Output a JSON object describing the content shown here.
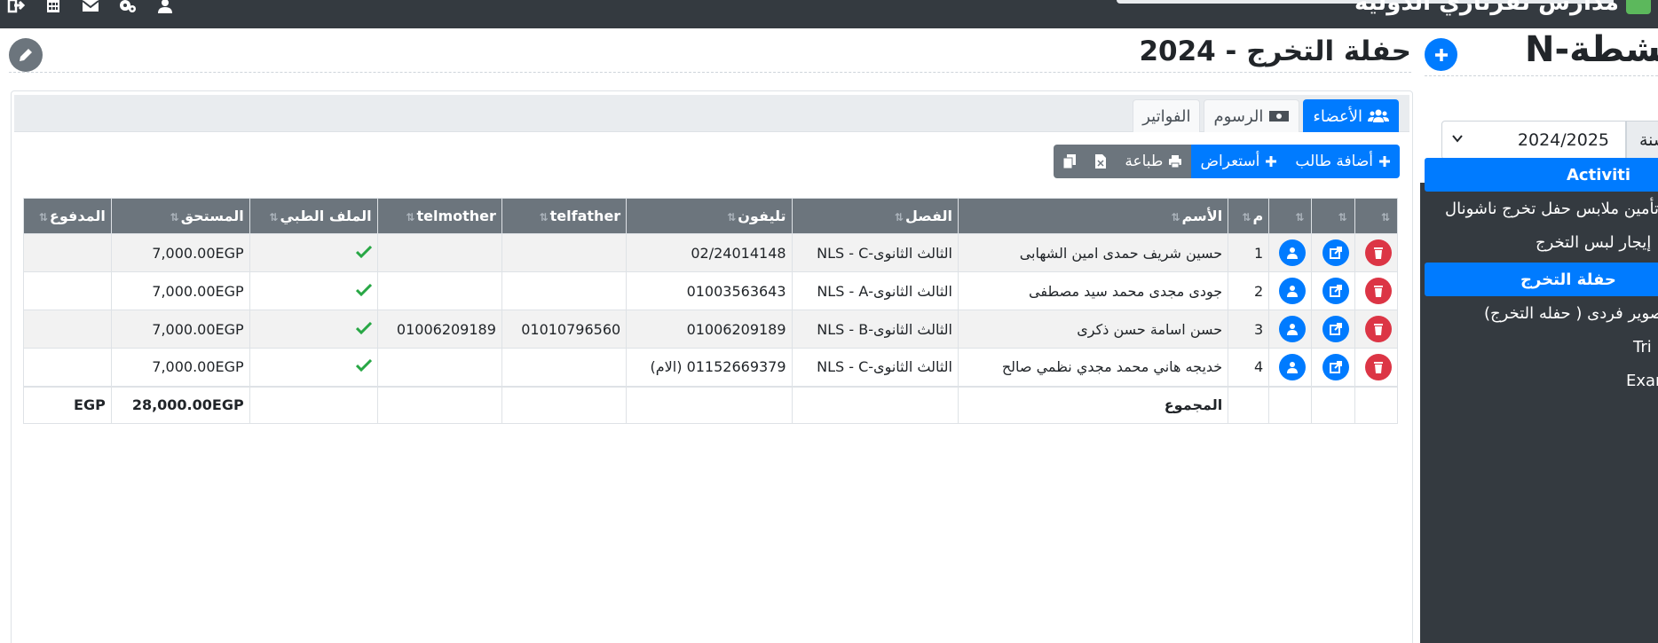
{
  "topbar": {
    "brand": "مدارس نفرتاري الدولية",
    "icons": [
      "sign-out-icon",
      "calculator-icon",
      "envelope-icon",
      "cogs-icon",
      "user-icon"
    ]
  },
  "main": {
    "title": "حفلة التخرج - 2024",
    "tabs": [
      {
        "label": "الأعضاء",
        "icon": "users-icon",
        "active": true
      },
      {
        "label": "الرسوم",
        "icon": "money-bill-icon",
        "active": false
      },
      {
        "label": "الفواتير",
        "icon": "",
        "active": false
      }
    ],
    "toolbar": {
      "add_student": "أضافة طالب",
      "browse": "أستعراض",
      "print": "طباعة",
      "excel_icon": "file-excel-icon",
      "copy_icon": "copy-icon"
    },
    "table": {
      "columns": [
        "",
        "",
        "",
        "م",
        "الأسم",
        "الفصل",
        "تليفون",
        "telfather",
        "telmother",
        "الملف الطبي",
        "المستحق",
        "المدفوع"
      ],
      "rows": [
        {
          "num": "1",
          "name": "حسين شريف حمدى امين الشهابى",
          "class": "الثالث الثانوى-NLS - C",
          "phone": "02/24014148",
          "telfather": "",
          "telmother": "",
          "medical": true,
          "due": "7,000.00EGP",
          "paid": ""
        },
        {
          "num": "2",
          "name": "جودى مجدى محمد سيد مصطفى",
          "class": "الثالث الثانوى-NLS - A",
          "phone": "01003563643",
          "telfather": "",
          "telmother": "",
          "medical": true,
          "due": "7,000.00EGP",
          "paid": ""
        },
        {
          "num": "3",
          "name": "حسن اسامة حسن ذكرى",
          "class": "الثالث الثانوى-NLS - B",
          "phone": "01006209189",
          "telfather": "01010796560",
          "telmother": "01006209189",
          "medical": true,
          "due": "7,000.00EGP",
          "paid": ""
        },
        {
          "num": "4",
          "name": "خديجه هاني محمد مجدي نظمي صالح",
          "class": "الثالث الثانوى-NLS - C",
          "phone": "01152669379 (الام)",
          "telfather": "",
          "telmother": "",
          "medical": true,
          "due": "7,000.00EGP",
          "paid": ""
        }
      ],
      "footer": {
        "label": "المجموع",
        "due_total": "28,000.00EGP",
        "paid_total": "EGP"
      }
    }
  },
  "sidebar": {
    "title": "N-انشطة",
    "year_label": "السنة",
    "year_value": "2024/2025",
    "items": [
      {
        "label": "Activiti",
        "head": true
      },
      {
        "label": "تأمين ملابس حفل تخرج ناشونال",
        "head": false
      },
      {
        "label": "إيجار لبس التخرج",
        "head": false
      },
      {
        "label": "حفلة التخرج",
        "head": true
      },
      {
        "label": "تصوير فردى ( حفله التخرج)",
        "head": false
      },
      {
        "label": "Tri",
        "head": false
      },
      {
        "label": "Exan",
        "head": false
      }
    ]
  },
  "colors": {
    "primary": "#007bff",
    "secondary": "#6c757d",
    "danger": "#dc3545",
    "success": "#28a745",
    "dark": "#343a40"
  }
}
